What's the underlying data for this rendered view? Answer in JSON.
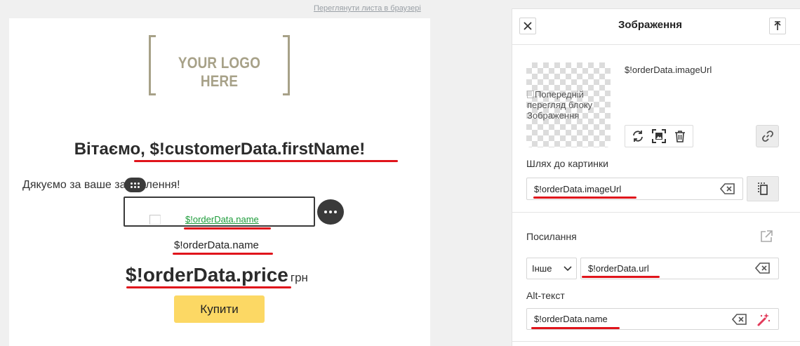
{
  "email": {
    "browser_link": "Переглянути листа в браузері",
    "logo_text": "YOUR LOGO HERE",
    "greeting_prefix": "Вітаємо, ",
    "greeting_var": "$!customerData.firstName!",
    "thanks_text": "Дякуємо за ваше замовлення!",
    "image_link": "$!orderData.name",
    "product_name": "$!orderData.name",
    "price": "$!orderData.price",
    "currency": "грн",
    "buy_button": "Купити"
  },
  "panel": {
    "title": "Зображення",
    "thumb_alt": "Попередній перегляд блоку Зображення",
    "image_url_caption": "$!orderData.imageUrl",
    "path_label": "Шлях до картинки",
    "path_value": "$!orderData.imageUrl",
    "link_label": "Посилання",
    "link_type": "Інше",
    "link_value": "$!orderData.url",
    "alt_label": "Alt-текст",
    "alt_value": "$!orderData.name"
  },
  "colors": {
    "accent_underline": "#e0141b",
    "buy_button_bg": "#fcd864",
    "link_green": "#1d9c3a",
    "logo_gold": "#a7a188"
  },
  "icons": [
    "close-icon",
    "collapse-icon",
    "replace-icon",
    "crop-icon",
    "trash-icon",
    "link-icon",
    "backspace-clear-icon",
    "copy-icon",
    "external-link-icon",
    "chevron-down-icon",
    "magic-wand-icon",
    "drag-handle-icon",
    "more-icon"
  ]
}
